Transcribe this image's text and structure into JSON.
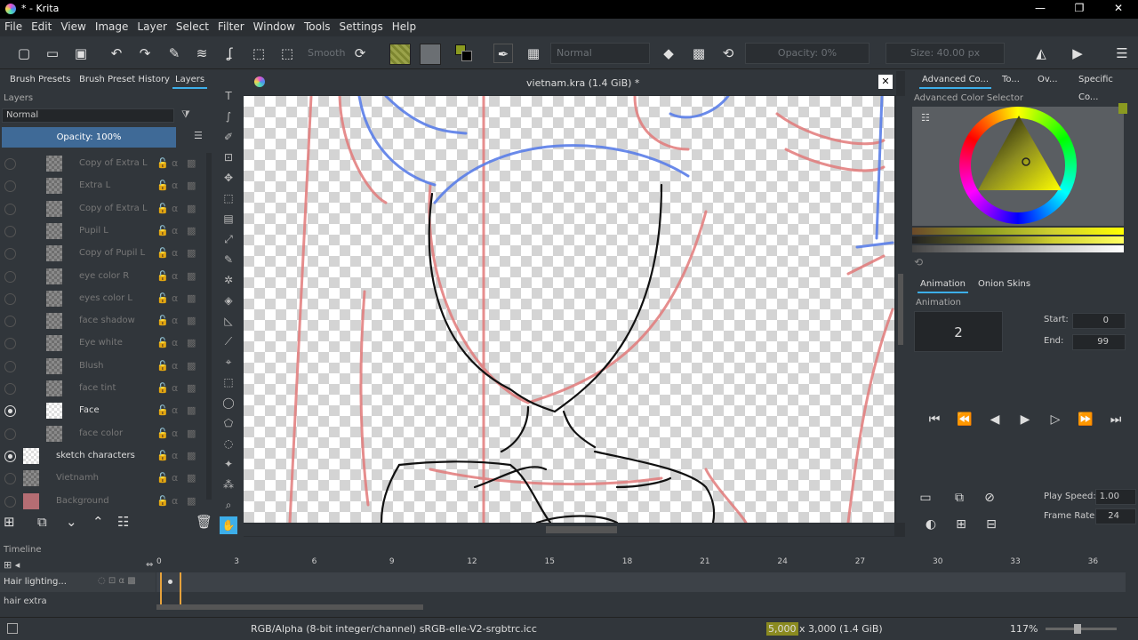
{
  "window": {
    "title": "* - Krita"
  },
  "menu": [
    "File",
    "Edit",
    "View",
    "Image",
    "Layer",
    "Select",
    "Filter",
    "Window",
    "Tools",
    "Settings",
    "Help"
  ],
  "toolbar": {
    "smooth_label": "Smooth",
    "blend_mode": "Normal",
    "opacity": "Opacity: 0%",
    "size": "Size: 40.00 px"
  },
  "left_tabs": [
    "Brush Presets",
    "Brush Preset History",
    "Layers"
  ],
  "layers_panel": {
    "title": "Layers",
    "blend": "Normal",
    "opacity": "Opacity:  100%",
    "layers": [
      {
        "name": "Copy of Extra L",
        "visible": false
      },
      {
        "name": "Extra L",
        "visible": false
      },
      {
        "name": "Copy of Extra L",
        "visible": false
      },
      {
        "name": "Pupil L",
        "visible": false
      },
      {
        "name": "Copy of Pupil L",
        "visible": false
      },
      {
        "name": "eye color R",
        "visible": false
      },
      {
        "name": "eyes color L",
        "visible": false
      },
      {
        "name": "face shadow",
        "visible": false
      },
      {
        "name": "Eye white",
        "visible": false
      },
      {
        "name": "Blush",
        "visible": false
      },
      {
        "name": "face tint",
        "visible": false
      },
      {
        "name": "Face",
        "visible": true
      },
      {
        "name": "face color",
        "visible": false
      },
      {
        "name": "sketch characters",
        "visible": true
      },
      {
        "name": "Vietnamh",
        "visible": false
      },
      {
        "name": "Background",
        "visible": false
      }
    ]
  },
  "document": {
    "tab_title": "vietnam.kra (1.4 GiB) *"
  },
  "right_tabs": [
    "Advanced Co...",
    "To...",
    "Ov...",
    "Specific Co..."
  ],
  "color_selector": {
    "title": "Advanced Color Selector"
  },
  "anim_tabs": [
    "Animation",
    "Onion Skins"
  ],
  "animation": {
    "title": "Animation",
    "frame": "2",
    "start_label": "Start:",
    "start": "0",
    "end_label": "End:",
    "end": "99",
    "play_speed_label": "Play Speed:",
    "play_speed": "1.00",
    "frame_rate_label": "Frame Rate:",
    "frame_rate": "24"
  },
  "timeline": {
    "title": "Timeline",
    "ticks": [
      "0",
      "3",
      "6",
      "9",
      "12",
      "15",
      "18",
      "21",
      "24",
      "27",
      "30",
      "33",
      "36"
    ],
    "layers": [
      "Hair lighting...",
      "hair extra"
    ]
  },
  "status": {
    "colorspace": "RGB/Alpha (8-bit integer/channel)  sRGB-elle-V2-srgbtrc.icc",
    "dimensions": "5,000 x 3,000 (1.4 GiB)",
    "zoom": "117%"
  }
}
